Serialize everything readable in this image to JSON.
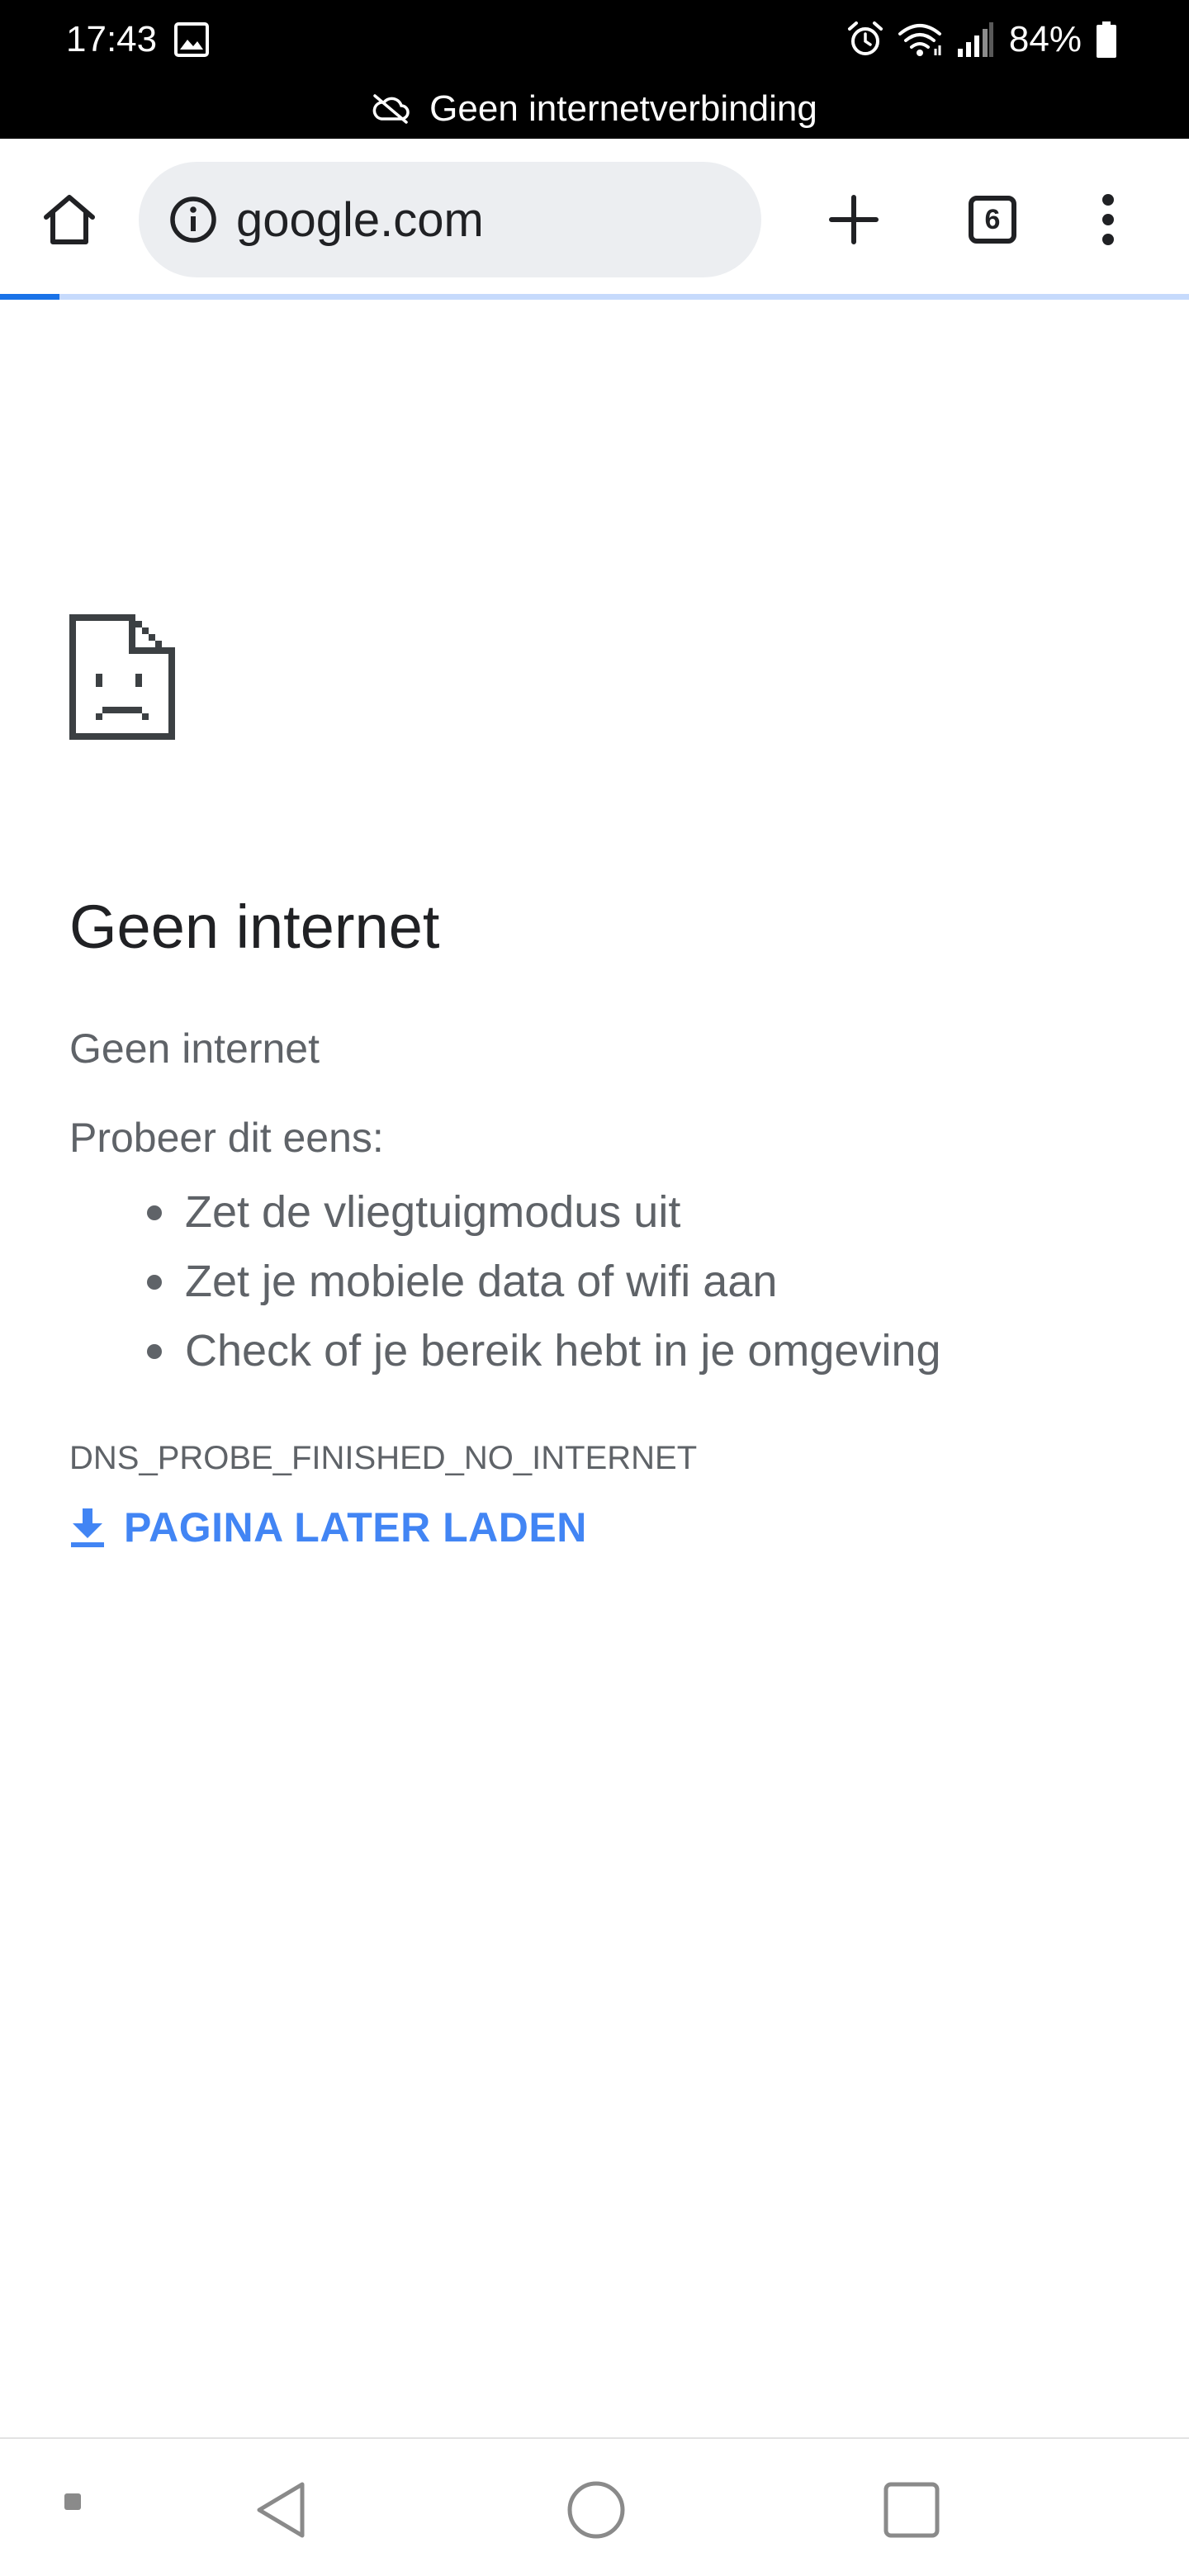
{
  "status_bar": {
    "time": "17:43",
    "battery": "84%",
    "offline_message": "Geen internetverbinding",
    "icons": [
      "gallery-icon",
      "alarm-icon",
      "wifi-icon",
      "signal-icon",
      "battery-icon",
      "cloud-off-icon"
    ]
  },
  "toolbar": {
    "url": "google.com",
    "tab_count": "6",
    "icons": [
      "home-icon",
      "info-icon",
      "plus-icon",
      "tab-switcher-icon",
      "more-vert-icon"
    ],
    "load_progress": 0.05,
    "colors": {
      "omnibox_bg": "#eceef1",
      "progress": "#1a73e8",
      "progress_track": "#c6dafc"
    }
  },
  "error_page": {
    "icon": "sad-page-icon",
    "heading": "Geen internet",
    "subheading": "Geen internet",
    "try_label": "Probeer dit eens:",
    "suggestions": [
      "Zet de vliegtuigmodus uit",
      "Zet je mobiele data of wifi aan",
      "Check of je bereik hebt in je omgeving"
    ],
    "error_code": "DNS_PROBE_FINISHED_NO_INTERNET",
    "download_later_label": "PAGINA LATER LADEN",
    "colors": {
      "link": "#4285f4",
      "text": "#5f6368",
      "heading": "#202124"
    }
  },
  "nav_bar": {
    "icons": [
      "dot-icon",
      "back-icon",
      "home-circle-icon",
      "recent-apps-icon"
    ]
  }
}
